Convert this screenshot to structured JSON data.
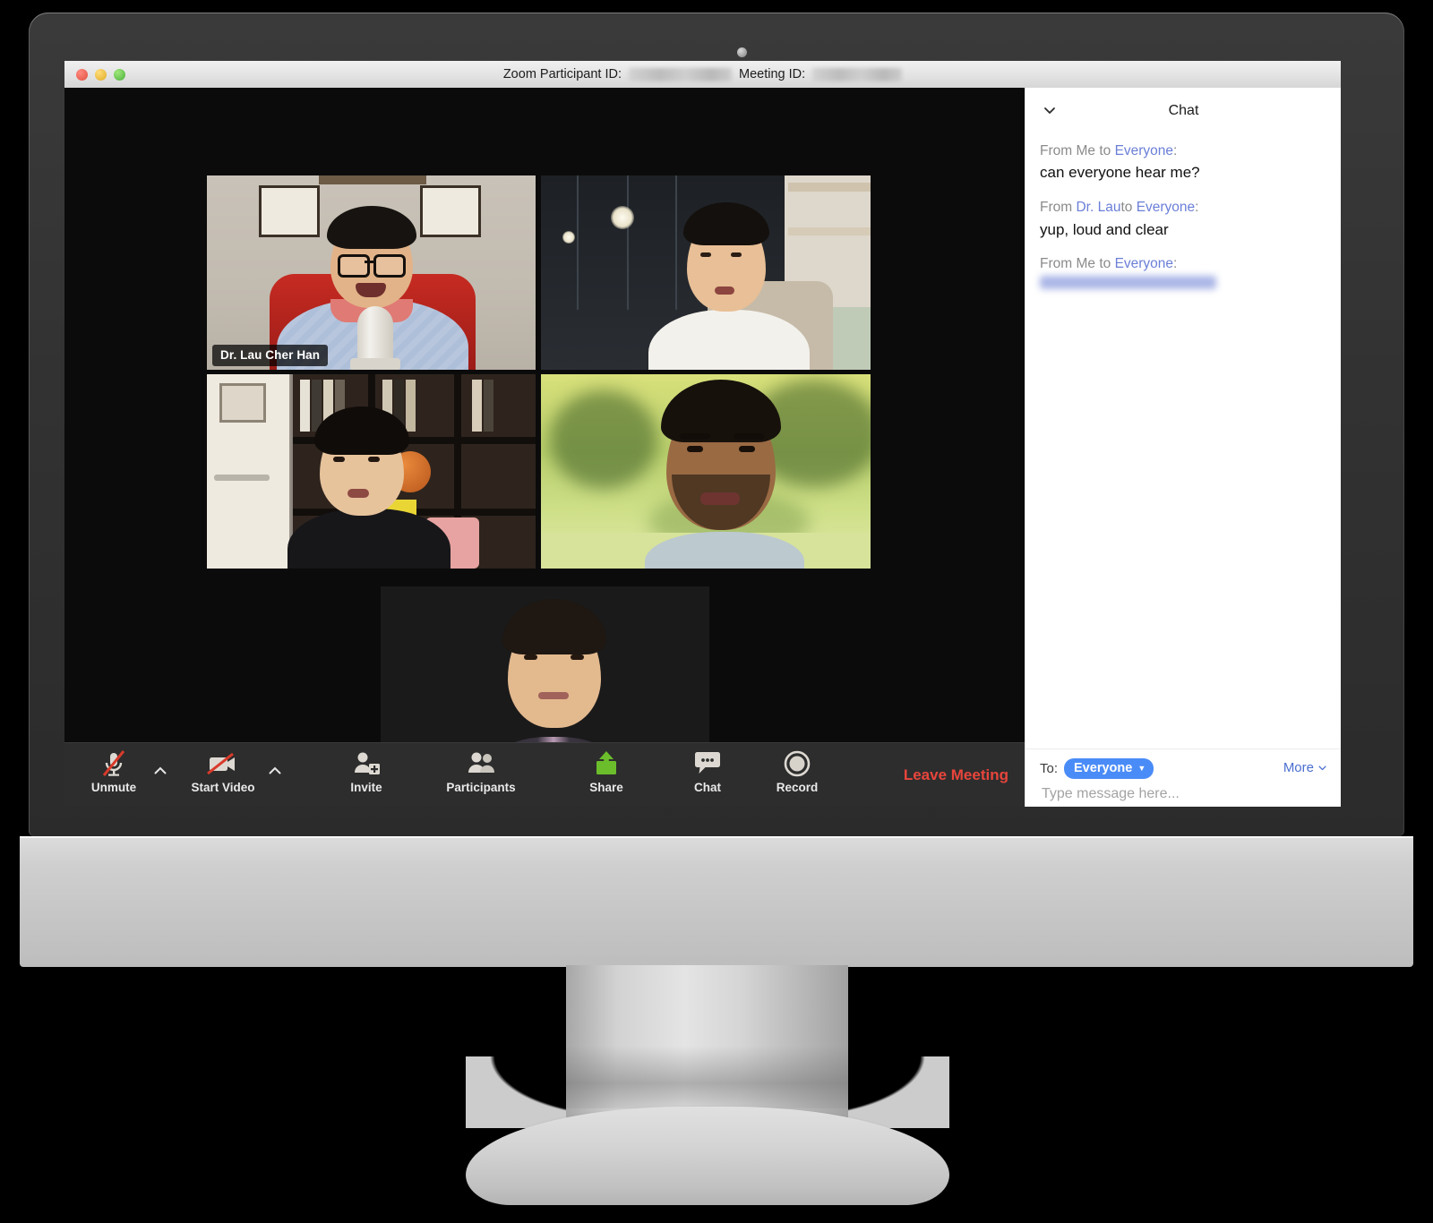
{
  "window": {
    "titlebar": {
      "participant_id_label": "Zoom Participant ID:",
      "participant_id_value": "",
      "meeting_id_label": "Meeting ID:",
      "meeting_id_value": ""
    },
    "traffic_lights": {
      "close": "close",
      "minimize": "minimize",
      "maximize": "maximize"
    }
  },
  "stage": {
    "tiles": [
      {
        "id": "tile-1",
        "name": "Dr. Lau Cher Han",
        "active_speaker": true,
        "show_name_tag": true
      },
      {
        "id": "tile-2",
        "name": "",
        "active_speaker": false,
        "show_name_tag": false
      },
      {
        "id": "tile-3",
        "name": "",
        "active_speaker": false,
        "show_name_tag": false
      },
      {
        "id": "tile-4",
        "name": "",
        "active_speaker": false,
        "show_name_tag": false
      },
      {
        "id": "tile-5",
        "name": "",
        "active_speaker": false,
        "show_name_tag": false
      }
    ],
    "active_border_color": "#f6ea18"
  },
  "toolbar": {
    "items": [
      {
        "label": "Unmute",
        "icon": "microphone-muted-icon",
        "has_caret": true,
        "state": "muted"
      },
      {
        "label": "Start Video",
        "icon": "video-off-icon",
        "has_caret": true,
        "state": "video-off"
      },
      {
        "label": "Invite",
        "icon": "invite-person-icon",
        "has_caret": false,
        "state": ""
      },
      {
        "label": "Participants",
        "icon": "participants-icon",
        "has_caret": false,
        "state": ""
      },
      {
        "label": "Share",
        "icon": "share-screen-icon",
        "has_caret": false,
        "state": ""
      },
      {
        "label": "Chat",
        "icon": "chat-bubble-icon",
        "has_caret": false,
        "state": ""
      },
      {
        "label": "Record",
        "icon": "record-circle-icon",
        "has_caret": false,
        "state": ""
      }
    ],
    "leave_meeting_label": "Leave Meeting",
    "leave_meeting_color": "#e8453c",
    "share_icon_color": "#6bbd2b",
    "mute_slash_color": "#d93a2b"
  },
  "chat": {
    "title": "Chat",
    "collapse_icon": "chevron-down-icon",
    "messages": [
      {
        "prefix": "From ",
        "sender": "Me",
        "middle": " to ",
        "recipient": "Everyone",
        "suffix": ":",
        "body": "can everyone hear me?",
        "blurred": false
      },
      {
        "prefix": "From ",
        "sender": "Dr. Lau",
        "middle": "to ",
        "recipient": "Everyone",
        "suffix": ":",
        "body": "yup, loud and clear",
        "blurred": false
      },
      {
        "prefix": "From ",
        "sender": "Me",
        "middle": " to ",
        "recipient": "Everyone",
        "suffix": ":",
        "body": "",
        "blurred": true
      }
    ],
    "footer": {
      "to_label": "To:",
      "to_value": "Everyone",
      "to_caret": "chevron-down-icon",
      "more_label": "More",
      "more_caret": "chevron-down-icon",
      "input_placeholder": "Type message here...",
      "input_value": "",
      "pill_color": "#4a8cf7",
      "link_color": "#4a6fd0"
    }
  }
}
